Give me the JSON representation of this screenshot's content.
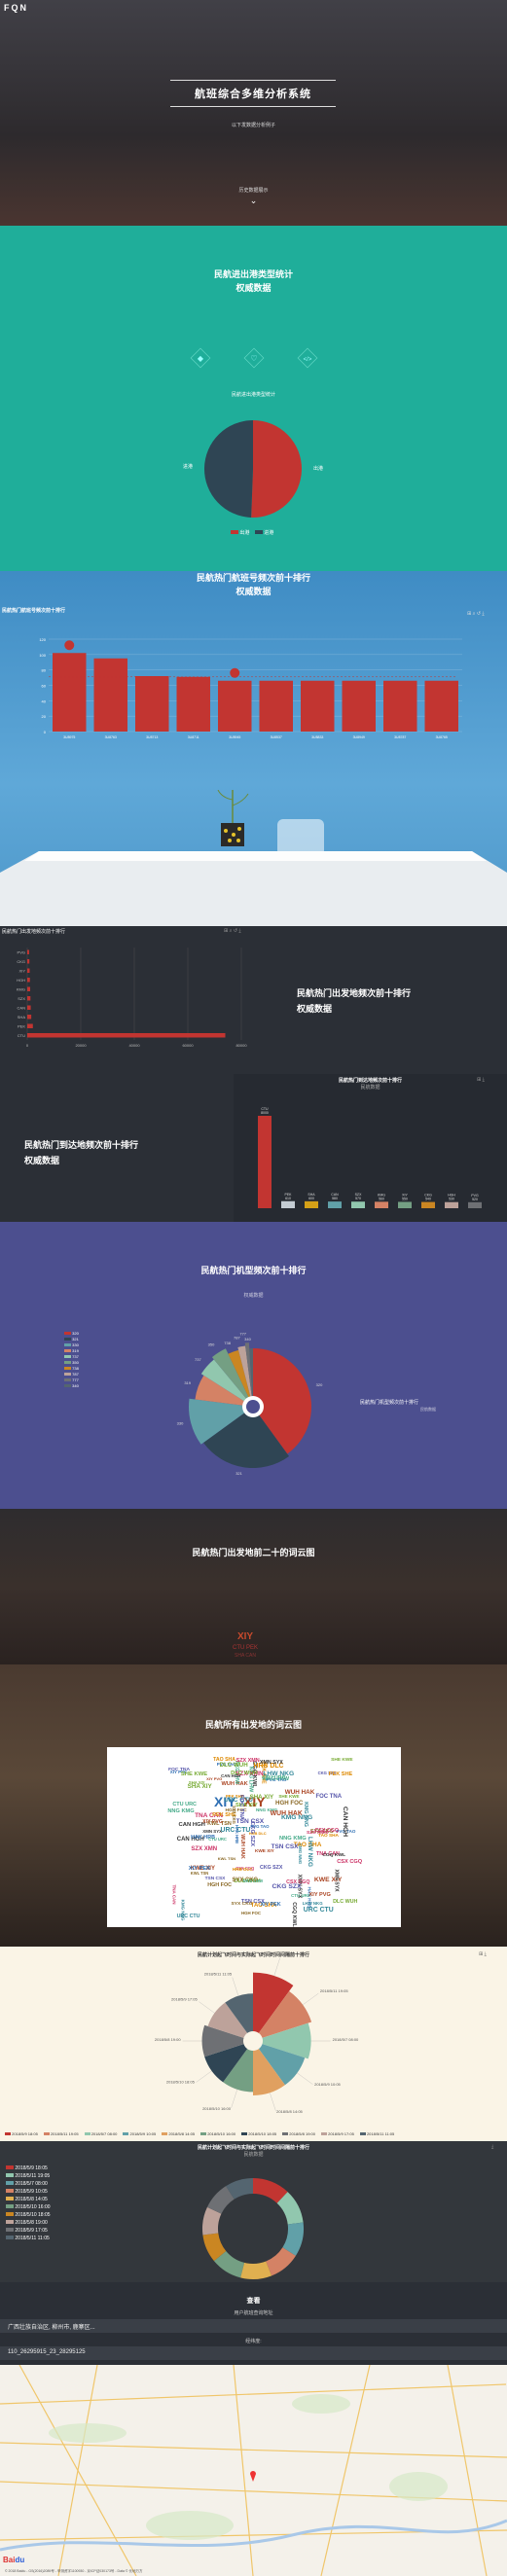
{
  "logo": "FQN",
  "hero": {
    "title": "航班综合多维分析系统",
    "subtitle": "以下发数据分析例子",
    "button": "历史数据展示"
  },
  "s2": {
    "title": "民航进出港类型统计",
    "subtitle": "权威数据",
    "chart_title": "民航进出港类型统计",
    "legend": [
      "出港",
      "进港"
    ]
  },
  "s3": {
    "title": "民航热门航班号频次前十排行",
    "subtitle": "权威数据",
    "chart_title": "民航热门航班号频次前十排行",
    "marker_top": "最大值",
    "marker_mid": "平均值"
  },
  "s4": {
    "title": "民航热门出发地频次前十排行",
    "subtitle": "权威数据",
    "chart_title": "民航热门出发地频次前十排行",
    "axis": [
      "0",
      "20000",
      "40000",
      "60000",
      "80000"
    ]
  },
  "s5": {
    "title": "民航热门到达地频次前十排行",
    "subtitle": "权威数据",
    "chart_title": "民航热门到达地频次前十排行",
    "chart_sub": "民航数据"
  },
  "s6": {
    "title": "民航热门机型频次前十排行",
    "subtitle": "权威数据",
    "side_title": "民航热门机型频次前十排行",
    "side_sub": "民航数据"
  },
  "s7": {
    "title": "民航热门出发地前二十的词云图"
  },
  "s8": {
    "title": "民航所有出发地的词云图"
  },
  "s9": {
    "title": "民航计划起飞时间与实际起飞时间时间间隔前十排行"
  },
  "s10": {
    "title": "民航计划起飞时间与实际起飞时间时间间隔前十排行",
    "sub": "民航数据",
    "legend": [
      "2018/5/9 18:05",
      "2018/5/11 19:05",
      "2018/5/7 08:00",
      "2018/5/9 10:05",
      "2018/5/8 14:05",
      "2018/5/10 16:00",
      "2018/5/10 18:05",
      "2018/5/8 19:00",
      "2018/5/9 17:05",
      "2018/5/11 11:05"
    ]
  },
  "query": {
    "heading": "查看",
    "label1": "用户航班查询地址",
    "input1": "广西壮族自治区, 柳州市, 鹿寨区...",
    "label2": "经纬度:",
    "input2": "110_26295915_23_28295125"
  },
  "footer": {
    "text": "© 2018 Baidu - GS(2016)2089号 - 甲测资字1100930 - 京ICP证030173号 - Data © 长地万方"
  },
  "colors": {
    "teal": "#1fae9a",
    "red": "#c23531",
    "navy": "#2f4554",
    "purple": "#4c4f8f",
    "dark": "#2b2f36"
  },
  "chart_data": [
    {
      "type": "pie",
      "title": "民航进出港类型统计",
      "categories": [
        "出港",
        "进港"
      ],
      "values": [
        50.6,
        49.4
      ]
    },
    {
      "type": "bar",
      "title": "民航热门航班号频次前十排行",
      "categories": [
        "3U8975",
        "3U8763",
        "3U8713",
        "3U8711",
        "3U8945",
        "3U8537",
        "3U8833",
        "3U8949",
        "3U8787",
        "3U8765"
      ],
      "values": [
        102,
        95,
        72,
        71,
        66,
        66,
        66,
        66,
        66,
        66
      ],
      "ylim": [
        0,
        120
      ]
    },
    {
      "type": "bar",
      "title": "民航热门出发地频次前十排行",
      "categories": [
        "CTU",
        "PEK",
        "SHA",
        "CAN",
        "SZX",
        "KMG",
        "HGH",
        "XIY",
        "CKG",
        "PVG"
      ],
      "values": [
        74000,
        2100,
        1500,
        1300,
        1200,
        1100,
        1000,
        900,
        800,
        700
      ],
      "xlim": [
        0,
        80000
      ]
    },
    {
      "type": "bar",
      "title": "民航热门到达地频次前十排行",
      "categories": [
        "CTU",
        "PEK",
        "SHA",
        "CAN",
        "SZX",
        "KMG",
        "XIY",
        "CKG",
        "HGH",
        "PVG"
      ],
      "values": [
        8000,
        610,
        600,
        580,
        570,
        560,
        550,
        540,
        530,
        520
      ],
      "labels": [
        "8000",
        "610",
        "600",
        "580",
        "570",
        "560",
        "550",
        "540",
        "530",
        "520"
      ]
    },
    {
      "type": "pie",
      "title": "民航热门机型频次前十排行",
      "categories": [
        "320",
        "321",
        "330",
        "319",
        "737",
        "350",
        "738",
        "787",
        "777",
        "340"
      ],
      "values": [
        40,
        25,
        12,
        7,
        5,
        4,
        3,
        2,
        1,
        1
      ]
    },
    {
      "type": "pie",
      "title": "民航计划起飞时间与实际起飞时间时间间隔前十排行",
      "categories": [
        "2018/5/9 18:05",
        "2018/5/11 19:05",
        "2018/5/7 08:00",
        "2018/5/9 10:05",
        "2018/5/8 14:05",
        "2018/5/10 16:00",
        "2018/5/10 18:05",
        "2018/5/8 19:00",
        "2018/5/9 17:05",
        "2018/5/11 11:05"
      ],
      "values": [
        14,
        12,
        11,
        10,
        10,
        9,
        9,
        9,
        8,
        8
      ]
    },
    {
      "type": "pie",
      "title": "民航计划起飞时间与实际起飞时间时间间隔前十排行",
      "categories": [
        "2018/5/9 18:05",
        "2018/5/11 19:05",
        "2018/5/7 08:00",
        "2018/5/9 10:05",
        "2018/5/8 14:05",
        "2018/5/10 16:00",
        "2018/5/10 18:05",
        "2018/5/8 19:00",
        "2018/5/9 17:05",
        "2018/5/11 11:05"
      ],
      "values": [
        12,
        11,
        11,
        10,
        10,
        10,
        9,
        9,
        9,
        9
      ]
    }
  ],
  "wordcloud": [
    "XIY",
    "XIY",
    "CTU",
    "PEK",
    "SHA",
    "CAN",
    "SZX",
    "KMG",
    "HGH",
    "CKG",
    "PVG",
    "WUH",
    "NKG",
    "TAO",
    "DLC",
    "XMN",
    "CSX",
    "URC",
    "SYX",
    "TSN",
    "HAK",
    "KWE",
    "NNG",
    "HRB",
    "SHE",
    "CGQ",
    "TNA",
    "LHW",
    "KWL",
    "FOC"
  ]
}
